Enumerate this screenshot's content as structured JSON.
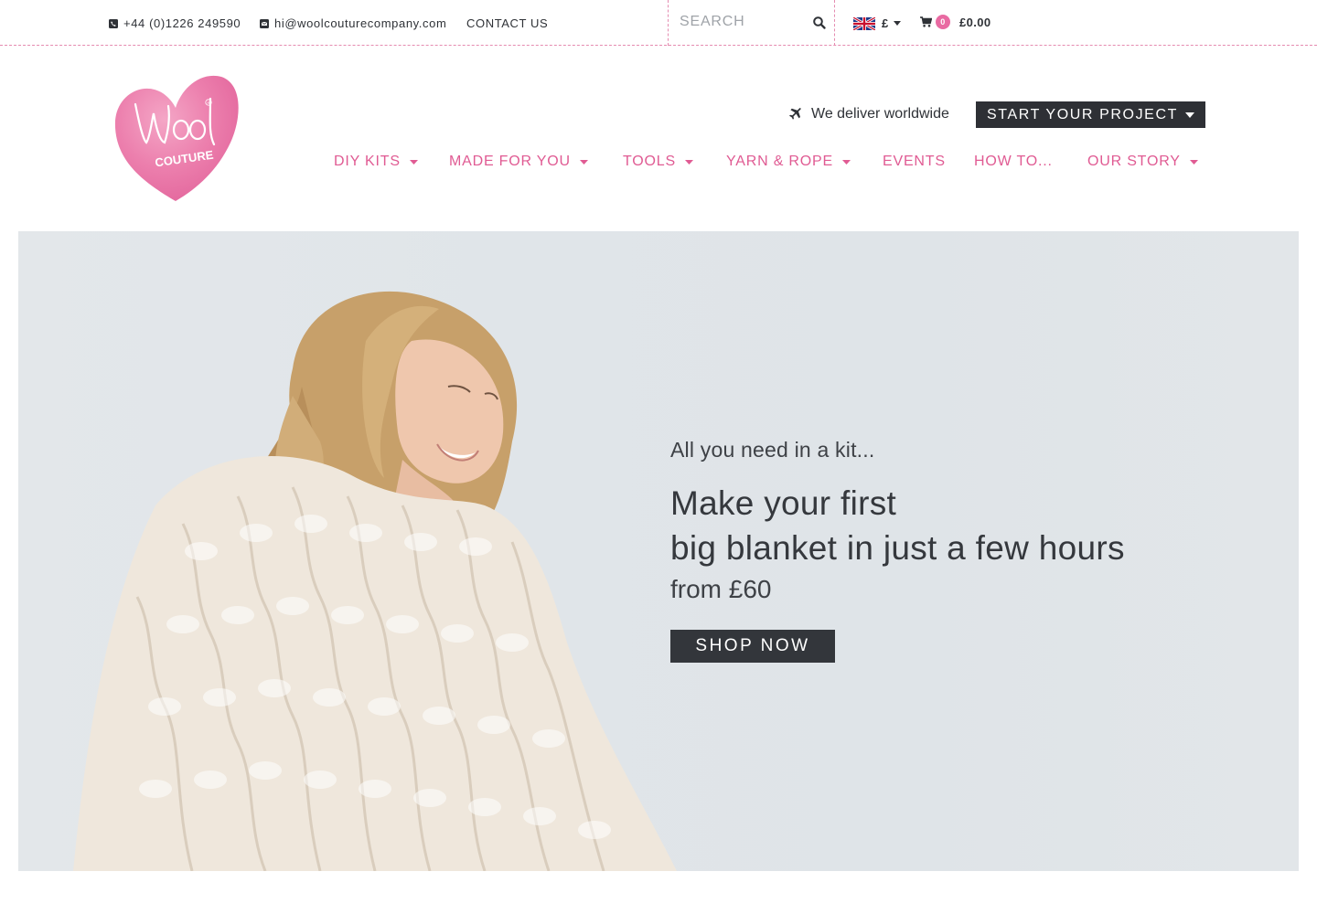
{
  "topbar": {
    "phone": "+44 (0)1226 249590",
    "email": "hi@woolcouturecompany.com",
    "contact_label": "CONTACT US",
    "search_placeholder": "SEARCH",
    "currency_symbol": "£",
    "cart_count": "0",
    "cart_total": "£0.00"
  },
  "header": {
    "logo_text_top": "wool",
    "logo_text_bottom": "COUTURE",
    "deliver_text": "We deliver worldwide",
    "start_project_label": "START YOUR PROJECT"
  },
  "nav": {
    "items": [
      {
        "label": "DIY KITS",
        "dropdown": true
      },
      {
        "label": "MADE FOR YOU",
        "dropdown": true
      },
      {
        "label": "TOOLS",
        "dropdown": true
      },
      {
        "label": "YARN & ROPE",
        "dropdown": true
      },
      {
        "label": "EVENTS",
        "dropdown": false
      },
      {
        "label": "HOW TO...",
        "dropdown": false
      },
      {
        "label": "OUR STORY",
        "dropdown": true
      }
    ]
  },
  "hero": {
    "eyebrow": "All you need in a kit...",
    "title_line1": "Make your first",
    "title_line2": "big blanket in just a few hours",
    "price": "from £60",
    "cta_label": "SHOP NOW"
  },
  "colors": {
    "brand_pink": "#e05b93",
    "dark": "#2e3035",
    "dashed_border": "#e58bb0"
  },
  "icons": {
    "phone": "phone-icon",
    "email": "envelope-icon",
    "search": "search-icon",
    "flag": "uk-flag-icon",
    "cart": "cart-icon",
    "deliver": "plane-icon",
    "dropdown": "caret-down-icon"
  }
}
